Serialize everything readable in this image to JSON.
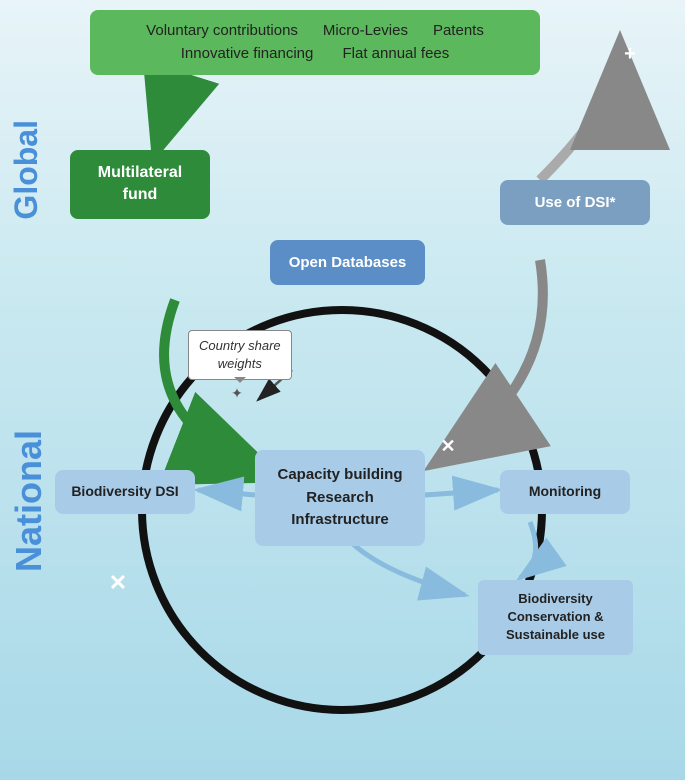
{
  "diagram": {
    "topBox": {
      "line1": "Voluntary contributions          Micro-Levies          Patents",
      "line2": "Innovative financing              Flat annual fees"
    },
    "multilateral": "Multilateral\nfund",
    "openDatabases": "Open Databases",
    "useDSI": "Use of DSI*",
    "capacityBuilding": "Capacity building\nResearch\nInfrastructure",
    "biodiversityDSI": "Biodiversity DSI",
    "monitoring": "Monitoring",
    "biodiversityConservation": "Biodiversity\nConservation &\nSustainable use",
    "countryWeights": "Country share\nweights",
    "sideLabels": {
      "global": "Global",
      "national": "National"
    }
  }
}
